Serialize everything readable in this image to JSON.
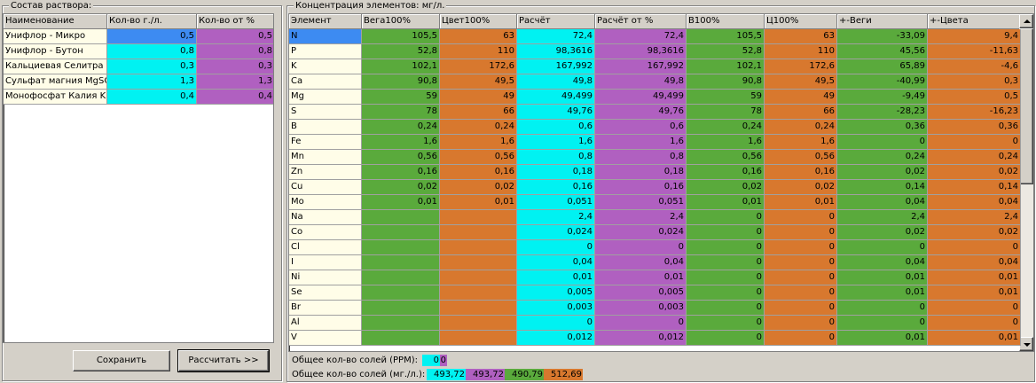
{
  "colors": {
    "cream": "#fffde8",
    "blue": "#3d8bf2",
    "cyan": "#00f2f2",
    "purple": "#b060c0",
    "green": "#5aaa3c",
    "orange": "#d8782e"
  },
  "left": {
    "title": "Состав раствора:",
    "columns": [
      "Наименование",
      "Кол-во г./л.",
      "Кол-во от %"
    ],
    "rows": [
      {
        "name": "Унифлор - Микро",
        "qty": "0,5",
        "pct": "0,5"
      },
      {
        "name": "Унифлор - Бутон",
        "qty": "0,8",
        "pct": "0,8"
      },
      {
        "name": "Кальциевая Селитра",
        "qty": "0,3",
        "pct": "0,3"
      },
      {
        "name": "Сульфат магния MgSO",
        "qty": "1,3",
        "pct": "1,3"
      },
      {
        "name": "Монофосфат Калия KH",
        "qty": "0,4",
        "pct": "0,4"
      }
    ],
    "save_label": "Сохранить",
    "calc_label": "Рассчитать >>"
  },
  "right": {
    "title": "Концентрация элементов: мг/л.",
    "columns": [
      "Элемент",
      "Вега100%",
      "Цвет100%",
      "Расчёт",
      "Расчёт от %",
      "В100%",
      "Ц100%",
      "+-Веги",
      "+-Цвета"
    ],
    "rows": [
      [
        "N",
        "105,5",
        "63",
        "72,4",
        "72,4",
        "105,5",
        "63",
        "-33,09",
        "9,4"
      ],
      [
        "P",
        "52,8",
        "110",
        "98,3616",
        "98,3616",
        "52,8",
        "110",
        "45,56",
        "-11,63"
      ],
      [
        "K",
        "102,1",
        "172,6",
        "167,992",
        "167,992",
        "102,1",
        "172,6",
        "65,89",
        "-4,6"
      ],
      [
        "Ca",
        "90,8",
        "49,5",
        "49,8",
        "49,8",
        "90,8",
        "49,5",
        "-40,99",
        "0,3"
      ],
      [
        "Mg",
        "59",
        "49",
        "49,499",
        "49,499",
        "59",
        "49",
        "-9,49",
        "0,5"
      ],
      [
        "S",
        "78",
        "66",
        "49,76",
        "49,76",
        "78",
        "66",
        "-28,23",
        "-16,23"
      ],
      [
        "B",
        "0,24",
        "0,24",
        "0,6",
        "0,6",
        "0,24",
        "0,24",
        "0,36",
        "0,36"
      ],
      [
        "Fe",
        "1,6",
        "1,6",
        "1,6",
        "1,6",
        "1,6",
        "1,6",
        "0",
        "0"
      ],
      [
        "Mn",
        "0,56",
        "0,56",
        "0,8",
        "0,8",
        "0,56",
        "0,56",
        "0,24",
        "0,24"
      ],
      [
        "Zn",
        "0,16",
        "0,16",
        "0,18",
        "0,18",
        "0,16",
        "0,16",
        "0,02",
        "0,02"
      ],
      [
        "Cu",
        "0,02",
        "0,02",
        "0,16",
        "0,16",
        "0,02",
        "0,02",
        "0,14",
        "0,14"
      ],
      [
        "Mo",
        "0,01",
        "0,01",
        "0,051",
        "0,051",
        "0,01",
        "0,01",
        "0,04",
        "0,04"
      ],
      [
        "Na",
        "",
        "",
        "2,4",
        "2,4",
        "0",
        "0",
        "2,4",
        "2,4"
      ],
      [
        "Co",
        "",
        "",
        "0,024",
        "0,024",
        "0",
        "0",
        "0,02",
        "0,02"
      ],
      [
        "Cl",
        "",
        "",
        "0",
        "0",
        "0",
        "0",
        "0",
        "0"
      ],
      [
        "I",
        "",
        "",
        "0,04",
        "0,04",
        "0",
        "0",
        "0,04",
        "0,04"
      ],
      [
        "Ni",
        "",
        "",
        "0,01",
        "0,01",
        "0",
        "0",
        "0,01",
        "0,01"
      ],
      [
        "Se",
        "",
        "",
        "0,005",
        "0,005",
        "0",
        "0",
        "0,01",
        "0,01"
      ],
      [
        "Br",
        "",
        "",
        "0,003",
        "0,003",
        "0",
        "0",
        "0",
        "0"
      ],
      [
        "Al",
        "",
        "",
        "0",
        "0",
        "0",
        "0",
        "0",
        "0"
      ],
      [
        "V",
        "",
        "",
        "0,012",
        "0,012",
        "0",
        "0",
        "0,01",
        "0,01"
      ]
    ],
    "ppm_label": "Общее кол-во солей (PPM):",
    "ppm_values": [
      "0",
      "0"
    ],
    "mgl_label": "Общее кол-во солей (мг./л.):",
    "mgl_values": [
      "493,72",
      "493,72",
      "490,79",
      "512,69"
    ]
  }
}
